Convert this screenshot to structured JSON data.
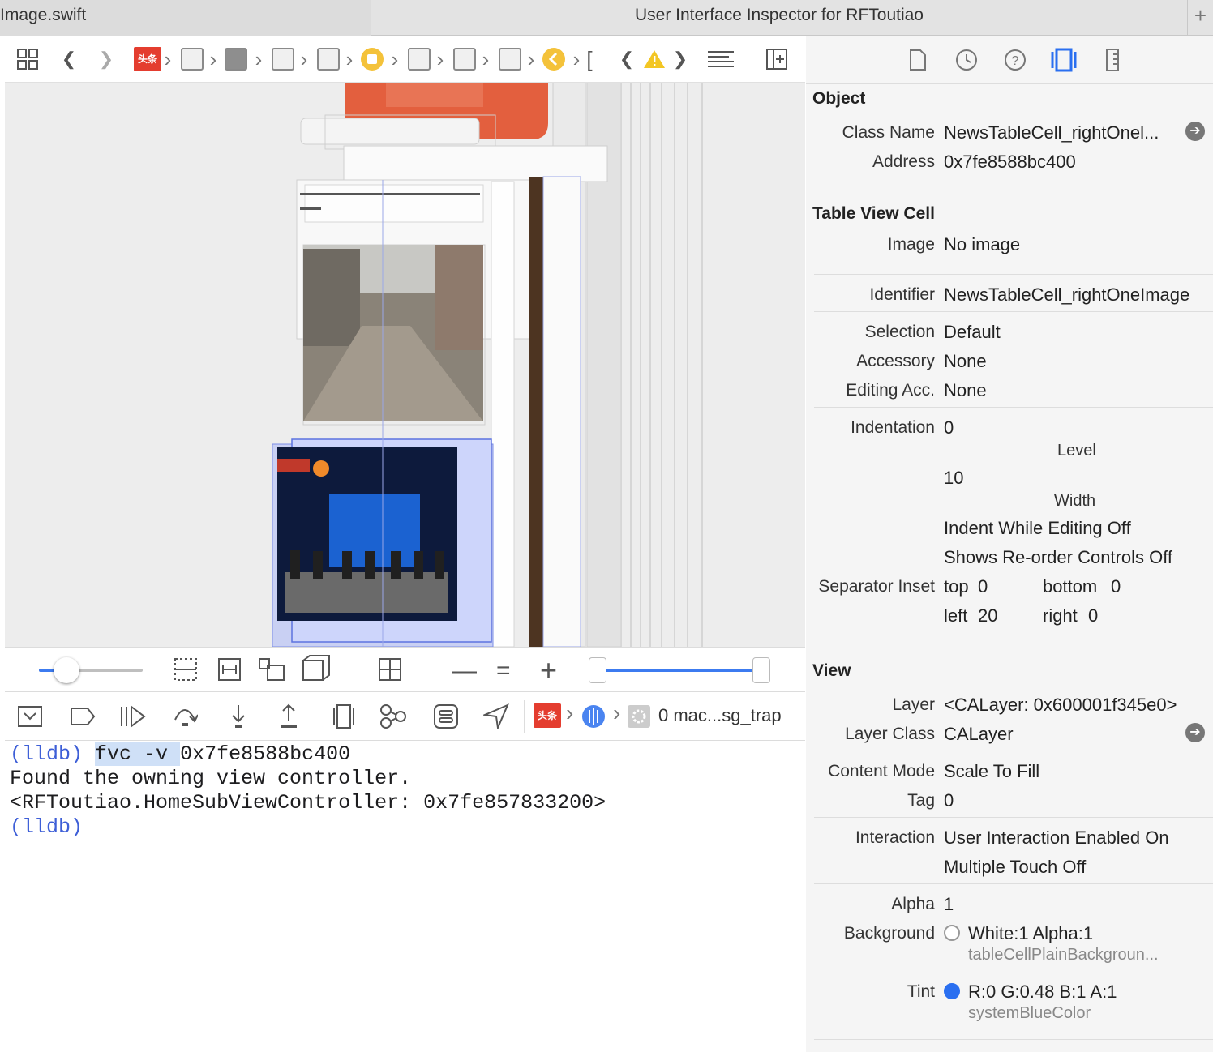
{
  "tabs": {
    "left": "Image.swift",
    "right": "User Interface Inspector for RFToutiao"
  },
  "jumpbar": {
    "logo_text": "头条"
  },
  "debug": {
    "logo_text": "头条",
    "thread_label": "0 mac...sg_trap"
  },
  "console": {
    "lines": [
      {
        "prompt": "(lldb)",
        "cmd": "fvc -v",
        "arg": "0x7fe8588bc400"
      },
      {
        "text": "Found the owning view controller."
      },
      {
        "text": "<RFToutiao.HomeSubViewController: 0x7fe857833200>"
      },
      {
        "prompt": "(lldb)"
      }
    ]
  },
  "inspector": {
    "object": {
      "title": "Object",
      "class_label": "Class Name",
      "class_value": "NewsTableCell_rightOnel...",
      "address_label": "Address",
      "address_value": "0x7fe8588bc400"
    },
    "cell": {
      "title": "Table View Cell",
      "image_label": "Image",
      "image_value": "No image",
      "identifier_label": "Identifier",
      "identifier_value": "NewsTableCell_rightOneImage",
      "selection_label": "Selection",
      "selection_value": "Default",
      "accessory_label": "Accessory",
      "accessory_value": "None",
      "editing_label": "Editing Acc.",
      "editing_value": "None",
      "indentation_label": "Indentation",
      "indentation_value": "0",
      "level_label": "Level",
      "width_value": "10",
      "width_label": "Width",
      "indent_editing": "Indent While Editing Off",
      "reorder": "Shows Re-order Controls Off",
      "separator_label": "Separator Inset",
      "top_label": "top",
      "top_value": "0",
      "bottom_label": "bottom",
      "bottom_value": "0",
      "left_label": "left",
      "left_value": "20",
      "right_label": "right",
      "right_value": "0"
    },
    "view": {
      "title": "View",
      "layer_label": "Layer",
      "layer_value": "<CALayer: 0x600001f345e0>",
      "layerclass_label": "Layer Class",
      "layerclass_value": "CALayer",
      "content_label": "Content Mode",
      "content_value": "Scale To Fill",
      "tag_label": "Tag",
      "tag_value": "0",
      "interaction_label": "Interaction",
      "interaction_value": "User Interaction Enabled On",
      "multitouch_value": "Multiple Touch Off",
      "alpha_label": "Alpha",
      "alpha_value": "1",
      "background_label": "Background",
      "background_value": "White:1 Alpha:1",
      "background_name": "tableCellPlainBackgroun...",
      "tint_label": "Tint",
      "tint_value": "R:0 G:0.48 B:1 A:1",
      "tint_name": "systemBlueColor",
      "tint_color": "#2a6ff0"
    }
  }
}
